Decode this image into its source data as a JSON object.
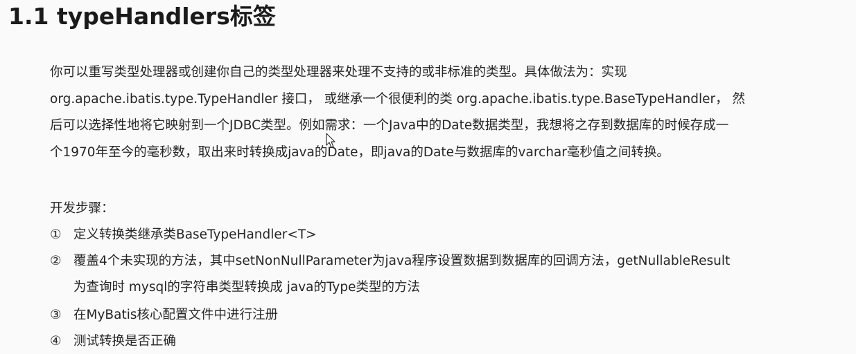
{
  "title": "1.1 typeHandlers标签",
  "paragraph": {
    "lines": [
      "你可以重写类型处理器或创建你自己的类型处理器来处理不支持的或非标准的类型。具体做法为：实现",
      "org.apache.ibatis.type.TypeHandler 接口， 或继承一个很便利的类 org.apache.ibatis.type.BaseTypeHandler， 然",
      "后可以选择性地将它映射到一个JDBC类型。例如需求：一个Java中的Date数据类型，我想将之存到数据库的时候存成一",
      "个1970年至今的毫秒数，取出来时转换成java的Date，即java的Date与数据库的varchar毫秒值之间转换。"
    ]
  },
  "steps": {
    "heading": "开发步骤：",
    "items": [
      {
        "num": "①",
        "text": "定义转换类继承类BaseTypeHandler<T>",
        "cont": ""
      },
      {
        "num": "②",
        "text": "覆盖4个未实现的方法，其中setNonNullParameter为java程序设置数据到数据库的回调方法，getNullableResult",
        "cont": "为查询时 mysql的字符串类型转换成 java的Type类型的方法"
      },
      {
        "num": "③",
        "text": "在MyBatis核心配置文件中进行注册",
        "cont": ""
      },
      {
        "num": "④",
        "text": "测试转换是否正确",
        "cont": ""
      }
    ]
  }
}
